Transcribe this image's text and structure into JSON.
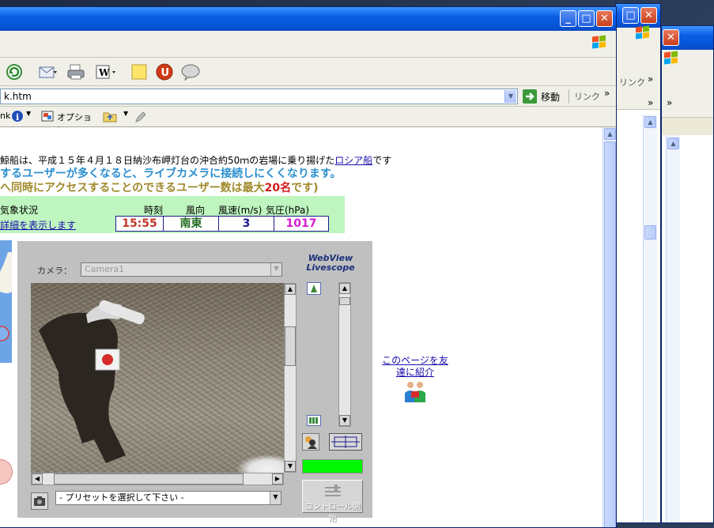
{
  "address": {
    "value": "k.htm",
    "go_label": "移動",
    "links_label": "リンク"
  },
  "back_windows": {
    "links_label": "リンク",
    "chevron": "»"
  },
  "toolbar_chevron": "»",
  "linkbar": {
    "left_text": "nk",
    "options_label": "オプション"
  },
  "page": {
    "line1_prefix": "鯨船は、平成１５年４月１８日納沙布岬灯台の沖合約50ｍの岩場に乗り揚げた",
    "line1_link": "ロシア船",
    "line1_suffix": "です",
    "line2": "するユーザーが多くなると、ライブカメラに接続しにくくなります。",
    "line3_prefix": "へ同時にアクセスすることのできるユーザー数は最大",
    "line3_count": "20名",
    "line3_suffix": "です)"
  },
  "weather": {
    "title": "気象状況",
    "detail_link": "詳細を表示します",
    "headers": {
      "time": "時刻",
      "direction": "風向",
      "speed": "風速(m/s)",
      "pressure": "気圧(hPa)"
    },
    "values": {
      "time": "15:55",
      "direction": "南東",
      "speed": "3",
      "pressure": "1017"
    },
    "colors": {
      "time": "#c0392b",
      "direction": "#1f6b1f",
      "speed": "#1a1a8c",
      "pressure": "#d61cd6"
    }
  },
  "webview": {
    "camera_label": "カメラ：",
    "camera_value": "Camera1",
    "logo_line1": "WebView",
    "logo_line2": "Livescope",
    "preset_value": "- プリセットを選択して下さい -",
    "control_label": "コントロール開始"
  },
  "side_link": {
    "line1": "このページを友",
    "line2": "達に紹介"
  }
}
